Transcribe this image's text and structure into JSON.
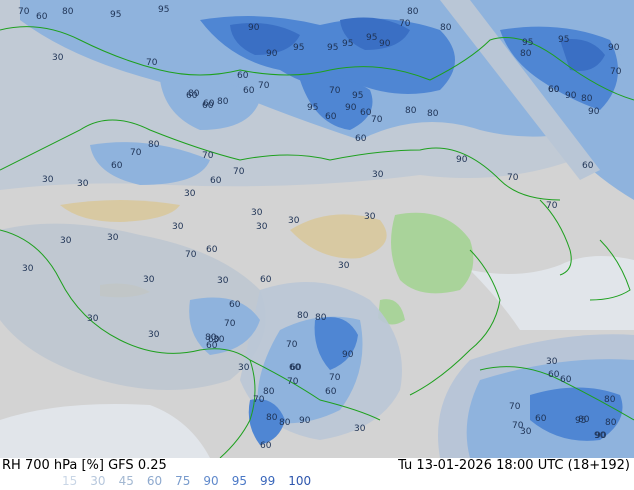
{
  "footer": {
    "title": "RH 700 hPa [%] GFS 0.25",
    "valid": "Tu 13-01-2026 18:00 UTC (18+192)",
    "legend": [
      {
        "label": "15",
        "color": "#c9d6e6"
      },
      {
        "label": "30",
        "color": "#b6c7dc"
      },
      {
        "label": "45",
        "color": "#a3b8d2"
      },
      {
        "label": "60",
        "color": "#8ea9ce"
      },
      {
        "label": "75",
        "color": "#799bcc"
      },
      {
        "label": "90",
        "color": "#6089cb"
      },
      {
        "label": "95",
        "color": "#4a78c6"
      },
      {
        "label": "99",
        "color": "#3a67bb"
      },
      {
        "label": "100",
        "color": "#2e56ad"
      }
    ]
  },
  "map": {
    "colors": {
      "land_dry": "#d9d9d9",
      "sea": "#e3e7ec",
      "desert": "#d8c9a2",
      "green": "#a9d39a",
      "rh30": "#b9c6d6",
      "rh60": "#8fb3dd",
      "rh75": "#6f9fd8",
      "rh90": "#4f86d3",
      "rh99": "#3a6fc4",
      "border": "#1ea01e"
    },
    "contour_labels": [
      "70",
      "60",
      "80",
      "95",
      "95",
      "90",
      "95",
      "90",
      "95",
      "95",
      "90",
      "95",
      "80",
      "70",
      "80",
      "95",
      "95",
      "90",
      "80",
      "60",
      "90",
      "70",
      "30",
      "70",
      "60",
      "80",
      "70",
      "60",
      "70",
      "80",
      "60",
      "90",
      "95",
      "60",
      "70",
      "80",
      "60",
      "80",
      "90",
      "60",
      "60",
      "80",
      "95",
      "70",
      "80",
      "60",
      "70",
      "70",
      "60",
      "60",
      "60",
      "30",
      "30",
      "30",
      "70",
      "90",
      "70",
      "60",
      "30",
      "30",
      "30",
      "30",
      "30",
      "30",
      "30",
      "30",
      "60",
      "70",
      "30",
      "30",
      "60",
      "30",
      "30",
      "60",
      "30",
      "30",
      "60",
      "70",
      "30",
      "60",
      "80",
      "30",
      "80",
      "70",
      "80",
      "60",
      "30",
      "80",
      "70",
      "60",
      "90",
      "70",
      "60",
      "80",
      "80",
      "90",
      "60",
      "70",
      "60",
      "30",
      "30",
      "60",
      "70",
      "60",
      "80",
      "70",
      "95",
      "80",
      "90",
      "80",
      "90"
    ]
  }
}
